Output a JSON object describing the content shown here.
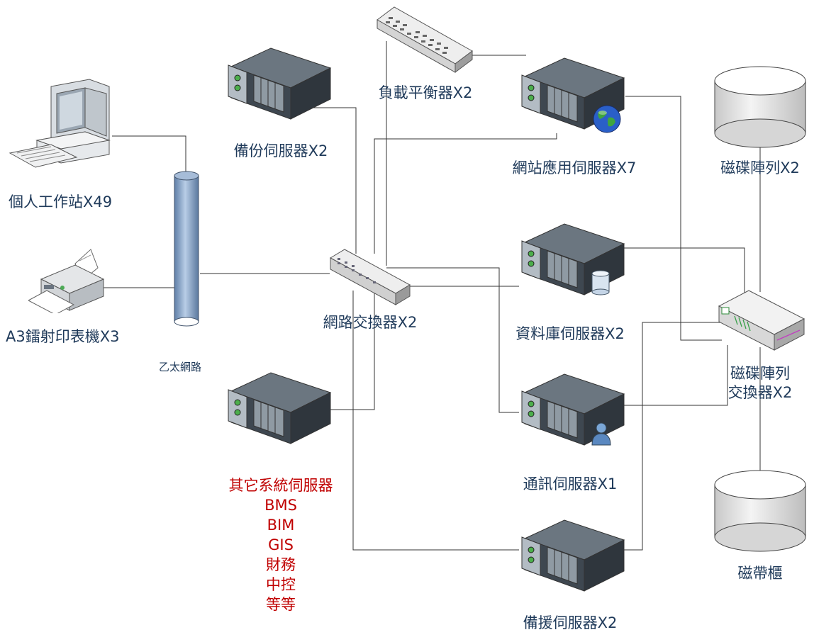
{
  "nodes": {
    "workstation": {
      "label": "個人工作站X49"
    },
    "printer": {
      "label": "A3鐳射印表機X3"
    },
    "ethernet": {
      "label": "乙太網路"
    },
    "backup_server": {
      "label": "備份伺服器X2"
    },
    "load_balancer": {
      "label": "負載平衡器X2"
    },
    "web_server": {
      "label": "網站應用伺服器X7"
    },
    "disk_array_top": {
      "label": "磁碟陣列X2"
    },
    "network_switch": {
      "label": "網路交換器X2"
    },
    "db_server": {
      "label": "資料庫伺服器X2"
    },
    "san_switch": {
      "label_lines": [
        "磁碟陣列",
        "交換器X2"
      ]
    },
    "other_servers": {
      "label_lines": [
        "其它系統伺服器",
        "BMS",
        "BIM",
        "GIS",
        "財務",
        "中控",
        "等等"
      ]
    },
    "comm_server": {
      "label": "通訊伺服器X1"
    },
    "tape_cabinet": {
      "label": "磁帶櫃"
    },
    "standby_server": {
      "label": "備援伺服器X2"
    }
  },
  "colors": {
    "line": "#333333",
    "label": "#1f3a5a",
    "label_highlight": "#c00000",
    "server_dark": "#4a5560",
    "server_light": "#8a949c",
    "pipe": "#8fb0d8"
  }
}
